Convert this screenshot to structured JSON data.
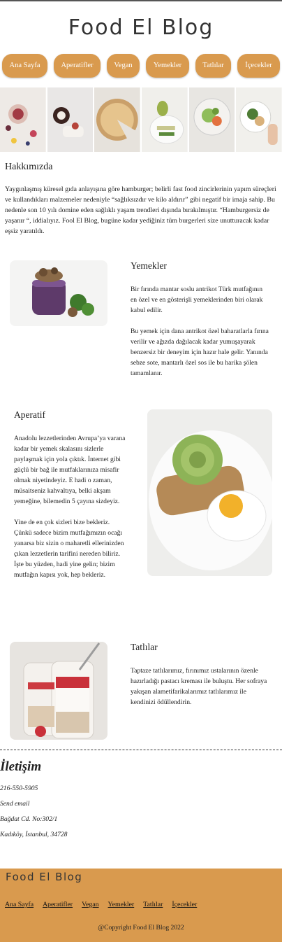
{
  "site": {
    "title": "Food El Blog"
  },
  "nav": [
    {
      "label": "Ana Sayfa"
    },
    {
      "label": "Aperatifler"
    },
    {
      "label": "Vegan"
    },
    {
      "label": "Yemekler"
    },
    {
      "label": "Tatlılar"
    },
    {
      "label": "İçecekler"
    }
  ],
  "about": {
    "heading": "Hakkımızda",
    "text": "Yaygınlaşmış küresel gıda anlayışına göre hamburger; belirli fast food zincirlerinin yapım süreçleri ve kullandıkları malzemeler nedeniyle “sağlıksızdır ve kilo aldırır” gibi negatif bir imaja sahip. Bu nedenle son 10 yılı domine eden sağlıklı yaşam trendleri dışında bırakılmıştır. “Hamburgersiz de yaşanır “, iddialıyız. Fool El Blog, bugüne kadar yediğiniz tüm burgerleri size unutturacak kadar eşsiz yaratıldı."
  },
  "sections": {
    "yemekler": {
      "heading": "Yemekler",
      "p1": "Bir fırında mantar soslu antrikot Türk mutfağının en özel ve en gösterişli yemeklerinden biri olarak kabul edilir.",
      "p2": "Bu yemek için dana antrikot özel baharatlarla fırına verilir ve ağızda dağılacak kadar yumuşayarak benzersiz bir deneyim için hazır hale gelir. Yanında sebze sote, mantarlı özel sos ile bu harika şölen tamamlanır."
    },
    "aperatif": {
      "heading": "Aperatif",
      "p1": "Anadolu lezzetlerinden Avrupa’ya varana kadar bir yemek skalasını sizlerle paylaşmak için yola çıktık. İnternet gibi güçlü bir bağ ile mutfaklarınıza misafir olmak niyetindeyiz. E hadi o zaman, müsaitseniz kahvaltıya, belki akşam yemeğine, bilemedin 5 çayına sizdeyiz.",
      "p2": "Yine de en çok sizleri bize bekleriz. Çünkü sadece bizim mutfağımızın ocağı yanarsa biz sizin o maharetli ellerinizden çıkan lezzetlerin tarifini nereden biliriz. İşte bu yüzden, hadi yine gelin; bizim mutfağın kapısı yok, hep bekleriz."
    },
    "tatlilar": {
      "heading": "Tatlılar",
      "p1": "Taptaze tatlılarımız, fırınımız ustalarının özenle hazırladığı pastacı kreması ile buluştu. Her sofraya yakışan alametifarikalarımız tatlılarımız ile kendinizi ödüllendirin."
    }
  },
  "contact": {
    "heading": "İletişim",
    "phone": "216-550-5905",
    "email": "Send email",
    "address1": "Bağdat Cd. No:302/1",
    "address2": "Kadıköy, İstanbul, 34728"
  },
  "footer": {
    "brand": "Food El Blog",
    "copyright": "@Copyright Food El Blog 2022"
  },
  "colors": {
    "accent": "#d99a4e"
  }
}
